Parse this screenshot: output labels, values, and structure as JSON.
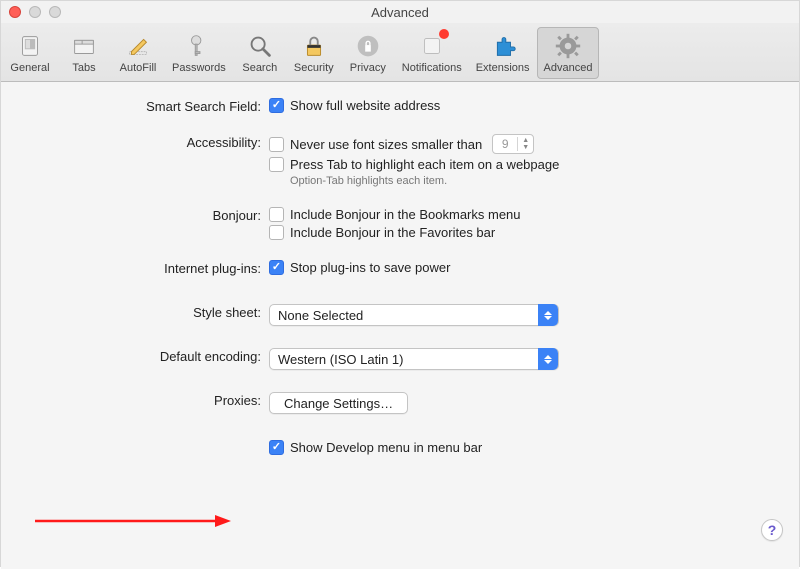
{
  "window": {
    "title": "Advanced"
  },
  "toolbar": {
    "items": [
      {
        "label": "General"
      },
      {
        "label": "Tabs"
      },
      {
        "label": "AutoFill"
      },
      {
        "label": "Passwords"
      },
      {
        "label": "Search"
      },
      {
        "label": "Security"
      },
      {
        "label": "Privacy"
      },
      {
        "label": "Notifications"
      },
      {
        "label": "Extensions"
      },
      {
        "label": "Advanced"
      }
    ],
    "active_index": 9
  },
  "sections": {
    "smart_search": {
      "label": "Smart Search Field:",
      "opt_show_full_url": "Show full website address",
      "checked_show_full_url": true
    },
    "accessibility": {
      "label": "Accessibility:",
      "opt_min_font": "Never use font sizes smaller than",
      "min_font_value": "9",
      "checked_min_font": false,
      "opt_tab_highlight": "Press Tab to highlight each item on a webpage",
      "checked_tab_highlight": false,
      "hint": "Option-Tab highlights each item."
    },
    "bonjour": {
      "label": "Bonjour:",
      "opt_bookmarks": "Include Bonjour in the Bookmarks menu",
      "checked_bookmarks": false,
      "opt_favorites": "Include Bonjour in the Favorites bar",
      "checked_favorites": false
    },
    "plugins": {
      "label": "Internet plug-ins:",
      "opt_stop": "Stop plug-ins to save power",
      "checked_stop": true
    },
    "stylesheet": {
      "label": "Style sheet:",
      "value": "None Selected"
    },
    "encoding": {
      "label": "Default encoding:",
      "value": "Western (ISO Latin 1)"
    },
    "proxies": {
      "label": "Proxies:",
      "button": "Change Settings…"
    },
    "develop": {
      "opt": "Show Develop menu in menu bar",
      "checked": true
    }
  },
  "help_glyph": "?"
}
